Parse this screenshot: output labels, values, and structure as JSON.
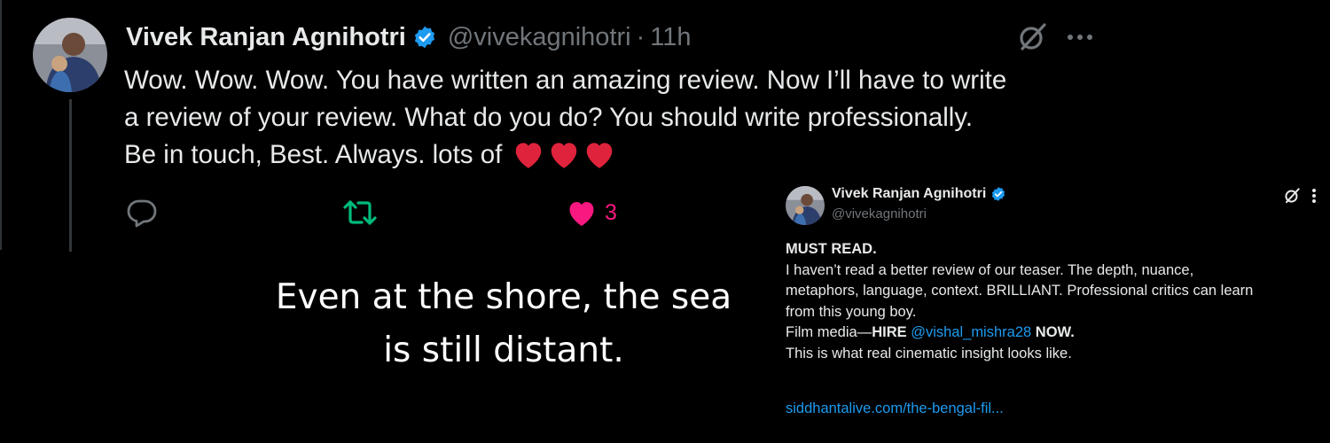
{
  "reply_tweet": {
    "author_name": "Vivek Ranjan Agnihotri",
    "handle": "@vivekagnihotri",
    "separator": "·",
    "time": "11h",
    "text_lines": [
      "Wow. Wow. Wow. You have written an amazing review. Now I’ll have to write",
      "a review of your review. What do you do? You should write professionally.",
      "Be in touch, Best. Always. lots of"
    ],
    "like_count": "3",
    "icons": [
      "verified-badge-icon",
      "grok-icon",
      "more-icon",
      "heart-icon",
      "reply-icon",
      "retweet-icon",
      "like-icon"
    ]
  },
  "caption": {
    "line1": "Even at the shore, the sea",
    "line2": "is still distant."
  },
  "quoted_tweet": {
    "author_name": "Vivek Ranjan Agnihotri",
    "handle": "@vivekagnihotri",
    "heading": "MUST READ.",
    "lines": [
      "I haven’t read a better review of our teaser. The depth, nuance,",
      "metaphors, language, context. BRILLIANT. Professional critics can learn",
      "from this young boy."
    ],
    "film_prefix": "Film media—",
    "film_hire": "HIRE",
    "mention": "@vishal_mishra28",
    "film_now": "NOW.",
    "closing": "This is what real cinematic insight looks like.",
    "link": "siddhantalive.com/the-bengal-fil..."
  },
  "colors": {
    "background": "#000000",
    "text": "#e7e9ea",
    "muted": "#71767b",
    "link": "#1d9bf0",
    "like": "#f91880",
    "retweet": "#00ba7c",
    "heart_emoji": "#e0233c"
  }
}
